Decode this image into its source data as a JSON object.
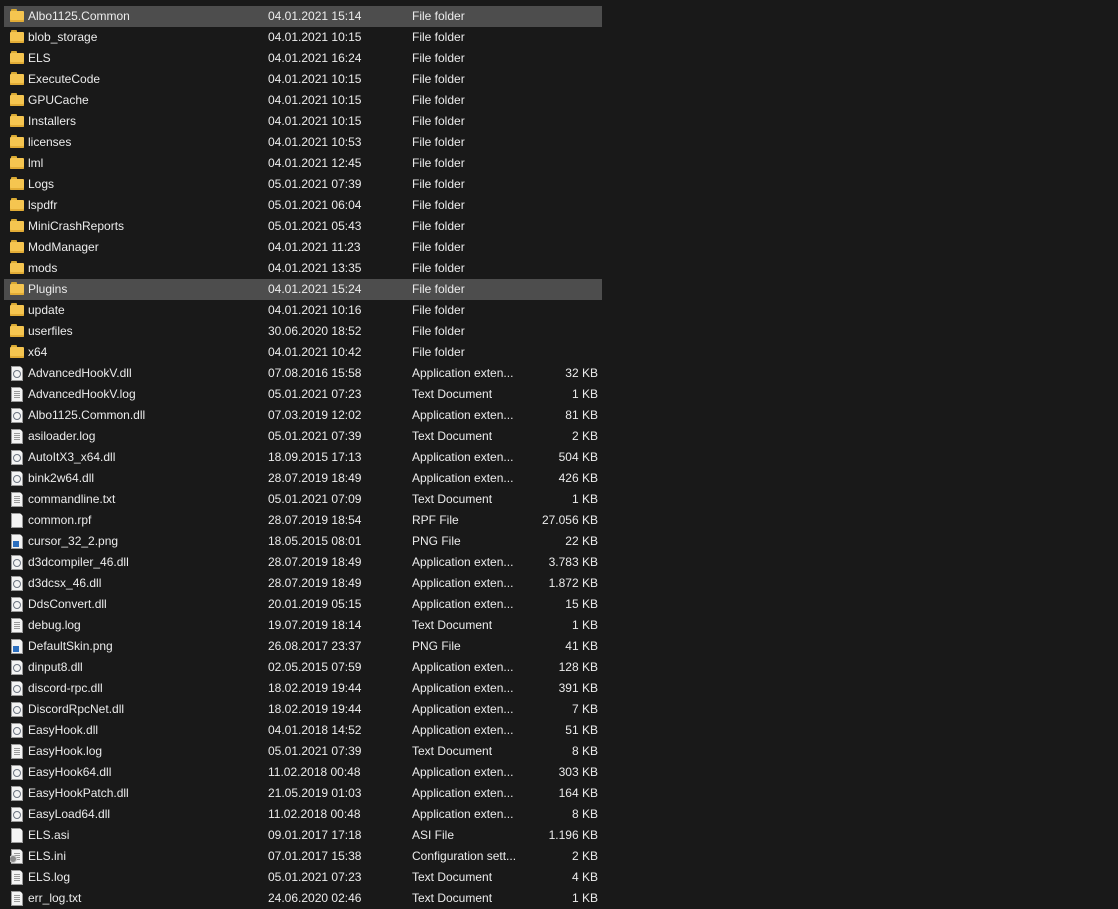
{
  "files": [
    {
      "name": "Albo1125.Common",
      "date": "04.01.2021 15:14",
      "type": "File folder",
      "size": "",
      "icon": "folder-icon",
      "selected": true
    },
    {
      "name": "blob_storage",
      "date": "04.01.2021 10:15",
      "type": "File folder",
      "size": "",
      "icon": "folder-icon"
    },
    {
      "name": "ELS",
      "date": "04.01.2021 16:24",
      "type": "File folder",
      "size": "",
      "icon": "folder-icon"
    },
    {
      "name": "ExecuteCode",
      "date": "04.01.2021 10:15",
      "type": "File folder",
      "size": "",
      "icon": "folder-icon"
    },
    {
      "name": "GPUCache",
      "date": "04.01.2021 10:15",
      "type": "File folder",
      "size": "",
      "icon": "folder-icon"
    },
    {
      "name": "Installers",
      "date": "04.01.2021 10:15",
      "type": "File folder",
      "size": "",
      "icon": "folder-icon"
    },
    {
      "name": "licenses",
      "date": "04.01.2021 10:53",
      "type": "File folder",
      "size": "",
      "icon": "folder-icon"
    },
    {
      "name": "lml",
      "date": "04.01.2021 12:45",
      "type": "File folder",
      "size": "",
      "icon": "folder-icon"
    },
    {
      "name": "Logs",
      "date": "05.01.2021 07:39",
      "type": "File folder",
      "size": "",
      "icon": "folder-icon"
    },
    {
      "name": "lspdfr",
      "date": "05.01.2021 06:04",
      "type": "File folder",
      "size": "",
      "icon": "folder-icon"
    },
    {
      "name": "MiniCrashReports",
      "date": "05.01.2021 05:43",
      "type": "File folder",
      "size": "",
      "icon": "folder-icon"
    },
    {
      "name": "ModManager",
      "date": "04.01.2021 11:23",
      "type": "File folder",
      "size": "",
      "icon": "folder-icon"
    },
    {
      "name": "mods",
      "date": "04.01.2021 13:35",
      "type": "File folder",
      "size": "",
      "icon": "folder-icon"
    },
    {
      "name": "Plugins",
      "date": "04.01.2021 15:24",
      "type": "File folder",
      "size": "",
      "icon": "folder-icon",
      "selected": true
    },
    {
      "name": "update",
      "date": "04.01.2021 10:16",
      "type": "File folder",
      "size": "",
      "icon": "folder-icon"
    },
    {
      "name": "userfiles",
      "date": "30.06.2020 18:52",
      "type": "File folder",
      "size": "",
      "icon": "folder-icon"
    },
    {
      "name": "x64",
      "date": "04.01.2021 10:42",
      "type": "File folder",
      "size": "",
      "icon": "folder-icon"
    },
    {
      "name": "AdvancedHookV.dll",
      "date": "07.08.2016 15:58",
      "type": "Application exten...",
      "size": "32 KB",
      "icon": "dll-file-icon"
    },
    {
      "name": "AdvancedHookV.log",
      "date": "05.01.2021 07:23",
      "type": "Text Document",
      "size": "1 KB",
      "icon": "text-file-icon"
    },
    {
      "name": "Albo1125.Common.dll",
      "date": "07.03.2019 12:02",
      "type": "Application exten...",
      "size": "81 KB",
      "icon": "dll-file-icon"
    },
    {
      "name": "asiloader.log",
      "date": "05.01.2021 07:39",
      "type": "Text Document",
      "size": "2 KB",
      "icon": "text-file-icon"
    },
    {
      "name": "AutoItX3_x64.dll",
      "date": "18.09.2015 17:13",
      "type": "Application exten...",
      "size": "504 KB",
      "icon": "dll-file-icon"
    },
    {
      "name": "bink2w64.dll",
      "date": "28.07.2019 18:49",
      "type": "Application exten...",
      "size": "426 KB",
      "icon": "dll-file-icon"
    },
    {
      "name": "commandline.txt",
      "date": "05.01.2021 07:09",
      "type": "Text Document",
      "size": "1 KB",
      "icon": "text-file-icon"
    },
    {
      "name": "common.rpf",
      "date": "28.07.2019 18:54",
      "type": "RPF File",
      "size": "27.056 KB",
      "icon": "blank-file-icon"
    },
    {
      "name": "cursor_32_2.png",
      "date": "18.05.2015 08:01",
      "type": "PNG File",
      "size": "22 KB",
      "icon": "image-file-icon"
    },
    {
      "name": "d3dcompiler_46.dll",
      "date": "28.07.2019 18:49",
      "type": "Application exten...",
      "size": "3.783 KB",
      "icon": "dll-file-icon"
    },
    {
      "name": "d3dcsx_46.dll",
      "date": "28.07.2019 18:49",
      "type": "Application exten...",
      "size": "1.872 KB",
      "icon": "dll-file-icon"
    },
    {
      "name": "DdsConvert.dll",
      "date": "20.01.2019 05:15",
      "type": "Application exten...",
      "size": "15 KB",
      "icon": "dll-file-icon"
    },
    {
      "name": "debug.log",
      "date": "19.07.2019 18:14",
      "type": "Text Document",
      "size": "1 KB",
      "icon": "text-file-icon"
    },
    {
      "name": "DefaultSkin.png",
      "date": "26.08.2017 23:37",
      "type": "PNG File",
      "size": "41 KB",
      "icon": "image-file-icon"
    },
    {
      "name": "dinput8.dll",
      "date": "02.05.2015 07:59",
      "type": "Application exten...",
      "size": "128 KB",
      "icon": "dll-file-icon"
    },
    {
      "name": "discord-rpc.dll",
      "date": "18.02.2019 19:44",
      "type": "Application exten...",
      "size": "391 KB",
      "icon": "dll-file-icon"
    },
    {
      "name": "DiscordRpcNet.dll",
      "date": "18.02.2019 19:44",
      "type": "Application exten...",
      "size": "7 KB",
      "icon": "dll-file-icon"
    },
    {
      "name": "EasyHook.dll",
      "date": "04.01.2018 14:52",
      "type": "Application exten...",
      "size": "51 KB",
      "icon": "dll-file-icon"
    },
    {
      "name": "EasyHook.log",
      "date": "05.01.2021 07:39",
      "type": "Text Document",
      "size": "8 KB",
      "icon": "text-file-icon"
    },
    {
      "name": "EasyHook64.dll",
      "date": "11.02.2018 00:48",
      "type": "Application exten...",
      "size": "303 KB",
      "icon": "dll-file-icon"
    },
    {
      "name": "EasyHookPatch.dll",
      "date": "21.05.2019 01:03",
      "type": "Application exten...",
      "size": "164 KB",
      "icon": "dll-file-icon"
    },
    {
      "name": "EasyLoad64.dll",
      "date": "11.02.2018 00:48",
      "type": "Application exten...",
      "size": "8 KB",
      "icon": "dll-file-icon"
    },
    {
      "name": "ELS.asi",
      "date": "09.01.2017 17:18",
      "type": "ASI File",
      "size": "1.196 KB",
      "icon": "blank-file-icon"
    },
    {
      "name": "ELS.ini",
      "date": "07.01.2017 15:38",
      "type": "Configuration sett...",
      "size": "2 KB",
      "icon": "config-file-icon"
    },
    {
      "name": "ELS.log",
      "date": "05.01.2021 07:23",
      "type": "Text Document",
      "size": "4 KB",
      "icon": "text-file-icon"
    },
    {
      "name": "err_log.txt",
      "date": "24.06.2020 02:46",
      "type": "Text Document",
      "size": "1 KB",
      "icon": "text-file-icon"
    }
  ]
}
